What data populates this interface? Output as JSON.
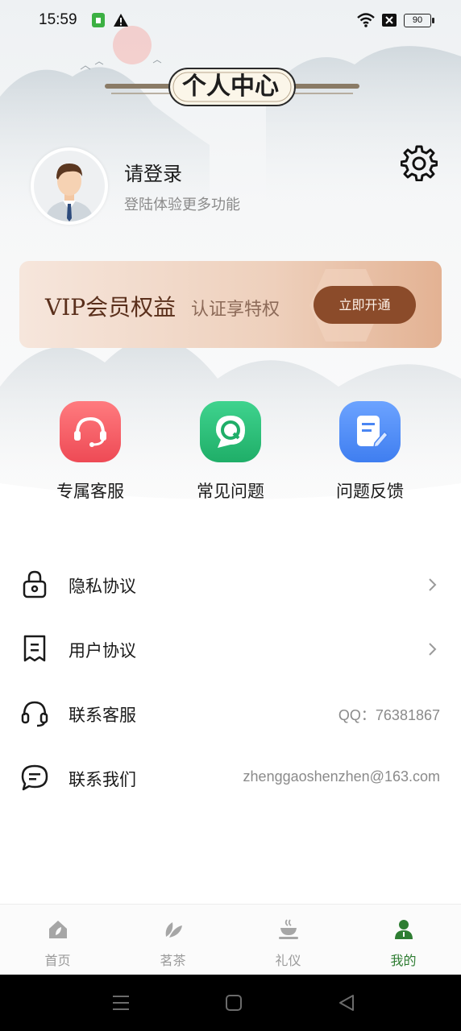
{
  "status": {
    "time": "15:59",
    "battery": "90"
  },
  "header": {
    "title": "个人中心"
  },
  "profile": {
    "title": "请登录",
    "subtitle": "登陆体验更多功能"
  },
  "vip": {
    "title": "VIP会员权益",
    "subtitle": "认证享特权",
    "button": "立即开通"
  },
  "quick_actions": [
    {
      "label": "专属客服",
      "icon": "headset-icon",
      "color": "#f2575f"
    },
    {
      "label": "常见问题",
      "icon": "faq-bubble-icon",
      "color": "#2cc079"
    },
    {
      "label": "问题反馈",
      "icon": "feedback-edit-icon",
      "color": "#4f8ef7"
    }
  ],
  "menu": [
    {
      "label": "隐私协议",
      "icon": "lock-icon",
      "value": ""
    },
    {
      "label": "用户协议",
      "icon": "document-icon",
      "value": ""
    },
    {
      "label": "联系客服",
      "icon": "headphones-icon",
      "value": "QQ：76381867"
    },
    {
      "label": "联系我们",
      "icon": "chat-icon",
      "value": "zhenggaoshenzhen@163.com"
    }
  ],
  "tabs": [
    {
      "label": "首页",
      "icon": "home-icon"
    },
    {
      "label": "茗茶",
      "icon": "tea-leaf-icon"
    },
    {
      "label": "礼仪",
      "icon": "teacup-icon"
    },
    {
      "label": "我的",
      "icon": "person-icon",
      "active": true
    }
  ],
  "colors": {
    "accent": "#2e7d32",
    "vip_button": "#8b4b2a"
  }
}
